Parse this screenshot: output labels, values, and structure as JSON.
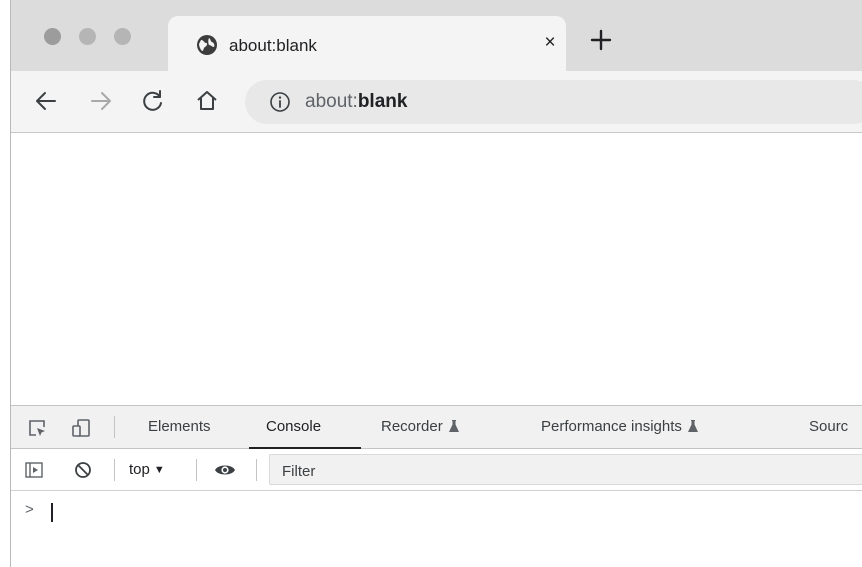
{
  "window": {
    "traffic_lights": [
      "close",
      "minimize",
      "maximize"
    ]
  },
  "tab": {
    "title": "about:blank",
    "icon": "globe-icon",
    "close_glyph": "×"
  },
  "toolbar": {
    "back_icon": "arrow-left-icon",
    "forward_icon": "arrow-right-icon",
    "reload_icon": "reload-icon",
    "home_icon": "home-icon",
    "url_host": "about:",
    "url_path": "blank"
  },
  "devtools": {
    "tabs": [
      {
        "label": "Elements"
      },
      {
        "label": "Console",
        "active": true
      },
      {
        "label": "Recorder",
        "experimental": true
      },
      {
        "label": "Performance insights",
        "experimental": true
      },
      {
        "label": "Sourc"
      }
    ],
    "console": {
      "context": "top",
      "filter_placeholder": "Filter",
      "prompt": ">"
    }
  },
  "colors": {
    "tabstrip": "#dcdcdc",
    "toolbar": "#f4f4f4",
    "omnibox": "#e8e8e8",
    "devtools_bar": "#f1f1f1"
  }
}
